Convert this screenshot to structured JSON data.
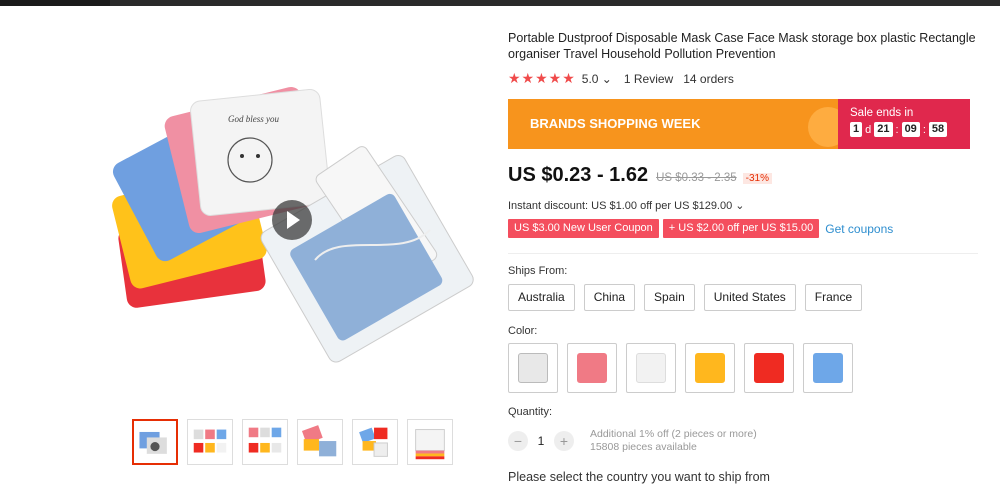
{
  "product": {
    "title": "Portable Dustproof Disposable Mask Case Face Mask storage box plastic Rectangle organiser Travel Household Pollution Prevention",
    "stars": "★★★★★",
    "score": "5.0",
    "score_chevron": "⌄",
    "reviews": "1 Review",
    "orders": "14 orders"
  },
  "gallery": {
    "product_image_text": "God bless you"
  },
  "banner": {
    "event": "BRANDS SHOPPING WEEK",
    "sale_label": "Sale ends in",
    "days": "1",
    "days_unit": "d",
    "hours": "21",
    "minutes": "09",
    "seconds": "58",
    "sep": ":"
  },
  "price": {
    "current": "US $0.23 - 1.62",
    "original": "US $0.33 - 2.35",
    "discount": "-31%"
  },
  "instant_discount": "Instant discount: US $1.00 off per US $129.00 ⌄",
  "coupons": {
    "items": [
      "US $3.00 New User Coupon",
      "+ US $2.00 off per US $15.00"
    ],
    "get": "Get coupons"
  },
  "ships_from": {
    "label": "Ships From:",
    "options": [
      "Australia",
      "China",
      "Spain",
      "United States",
      "France"
    ]
  },
  "color": {
    "label": "Color:",
    "swatches": [
      "#e8e8e8",
      "#f07a85",
      "#f2f2f2",
      "#ffb71e",
      "#ef2b22",
      "#6ea7e8"
    ]
  },
  "quantity": {
    "label": "Quantity:",
    "minus": "−",
    "value": "1",
    "plus": "+",
    "note1": "Additional 1% off (2 pieces or more)",
    "note2": "15808 pieces available"
  },
  "ship_note": "Please select the country you want to ship from",
  "colors": {
    "banner_orange": "#f7941d",
    "banner_red": "#e0284d",
    "coupon_red": "#f44e5e",
    "accent": "#e62e04",
    "link": "#2e8ecf",
    "star": "#f04b4b"
  }
}
